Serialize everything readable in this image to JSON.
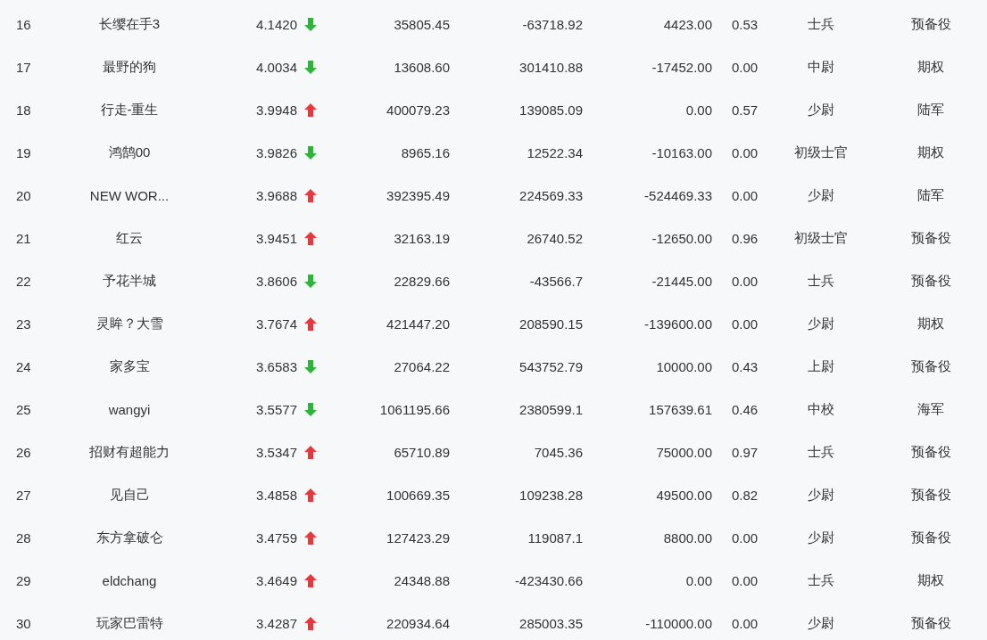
{
  "rows": [
    {
      "rank": "16",
      "name": "长缨在手3",
      "score": "4.1420",
      "rising": false,
      "column_5": "35805.45",
      "column_6": "-63718.92",
      "column_7": "4423.00",
      "column_8": "0.53",
      "column_9": "士兵",
      "column_10": "预备役"
    },
    {
      "rank": "17",
      "name": "最野的狗",
      "score": "4.0034",
      "rising": false,
      "column_5": "13608.60",
      "column_6": "301410.88",
      "column_7": "-17452.00",
      "column_8": "0.00",
      "column_9": "中尉",
      "column_10": "期权"
    },
    {
      "rank": "18",
      "name": "行走-重生",
      "score": "3.9948",
      "rising": true,
      "column_5": "400079.23",
      "column_6": "139085.09",
      "column_7": "0.00",
      "column_8": "0.57",
      "column_9": "少尉",
      "column_10": "陆军"
    },
    {
      "rank": "19",
      "name": "鸿鹄00",
      "score": "3.9826",
      "rising": false,
      "column_5": "8965.16",
      "column_6": "12522.34",
      "column_7": "-10163.00",
      "column_8": "0.00",
      "column_9": "初级士官",
      "column_10": "期权"
    },
    {
      "rank": "20",
      "name": "NEW WOR...",
      "score": "3.9688",
      "rising": true,
      "column_5": "392395.49",
      "column_6": "224569.33",
      "column_7": "-524469.33",
      "column_8": "0.00",
      "column_9": "少尉",
      "column_10": "陆军"
    },
    {
      "rank": "21",
      "name": "红云",
      "score": "3.9451",
      "rising": true,
      "column_5": "32163.19",
      "column_6": "26740.52",
      "column_7": "-12650.00",
      "column_8": "0.96",
      "column_9": "初级士官",
      "column_10": "预备役"
    },
    {
      "rank": "22",
      "name": "予花半城",
      "score": "3.8606",
      "rising": false,
      "column_5": "22829.66",
      "column_6": "-43566.7",
      "column_7": "-21445.00",
      "column_8": "0.00",
      "column_9": "士兵",
      "column_10": "预备役"
    },
    {
      "rank": "23",
      "name": "灵眸？大雪",
      "score": "3.7674",
      "rising": true,
      "column_5": "421447.20",
      "column_6": "208590.15",
      "column_7": "-139600.00",
      "column_8": "0.00",
      "column_9": "少尉",
      "column_10": "期权"
    },
    {
      "rank": "24",
      "name": "家多宝",
      "score": "3.6583",
      "rising": false,
      "column_5": "27064.22",
      "column_6": "543752.79",
      "column_7": "10000.00",
      "column_8": "0.43",
      "column_9": "上尉",
      "column_10": "预备役"
    },
    {
      "rank": "25",
      "name": "wangyi",
      "score": "3.5577",
      "rising": false,
      "column_5": "1061195.66",
      "column_6": "2380599.1",
      "column_7": "157639.61",
      "column_8": "0.46",
      "column_9": "中校",
      "column_10": "海军"
    },
    {
      "rank": "26",
      "name": "招财有超能力",
      "score": "3.5347",
      "rising": true,
      "column_5": "65710.89",
      "column_6": "7045.36",
      "column_7": "75000.00",
      "column_8": "0.97",
      "column_9": "士兵",
      "column_10": "预备役"
    },
    {
      "rank": "27",
      "name": "见自己",
      "score": "3.4858",
      "rising": true,
      "column_5": "100669.35",
      "column_6": "109238.28",
      "column_7": "49500.00",
      "column_8": "0.82",
      "column_9": "少尉",
      "column_10": "预备役"
    },
    {
      "rank": "28",
      "name": "东方拿破仑",
      "score": "3.4759",
      "rising": true,
      "column_5": "127423.29",
      "column_6": "119087.1",
      "column_7": "8800.00",
      "column_8": "0.00",
      "column_9": "少尉",
      "column_10": "预备役"
    },
    {
      "rank": "29",
      "name": "eldchang",
      "score": "3.4649",
      "rising": true,
      "column_5": "24348.88",
      "column_6": "-423430.66",
      "column_7": "0.00",
      "column_8": "0.00",
      "column_9": "士兵",
      "column_10": "期权"
    },
    {
      "rank": "30",
      "name": "玩家巴雷特",
      "score": "3.4287",
      "rising": true,
      "column_5": "220934.64",
      "column_6": "285003.35",
      "column_7": "-110000.00",
      "column_8": "0.00",
      "column_9": "少尉",
      "column_10": "预备役"
    }
  ]
}
